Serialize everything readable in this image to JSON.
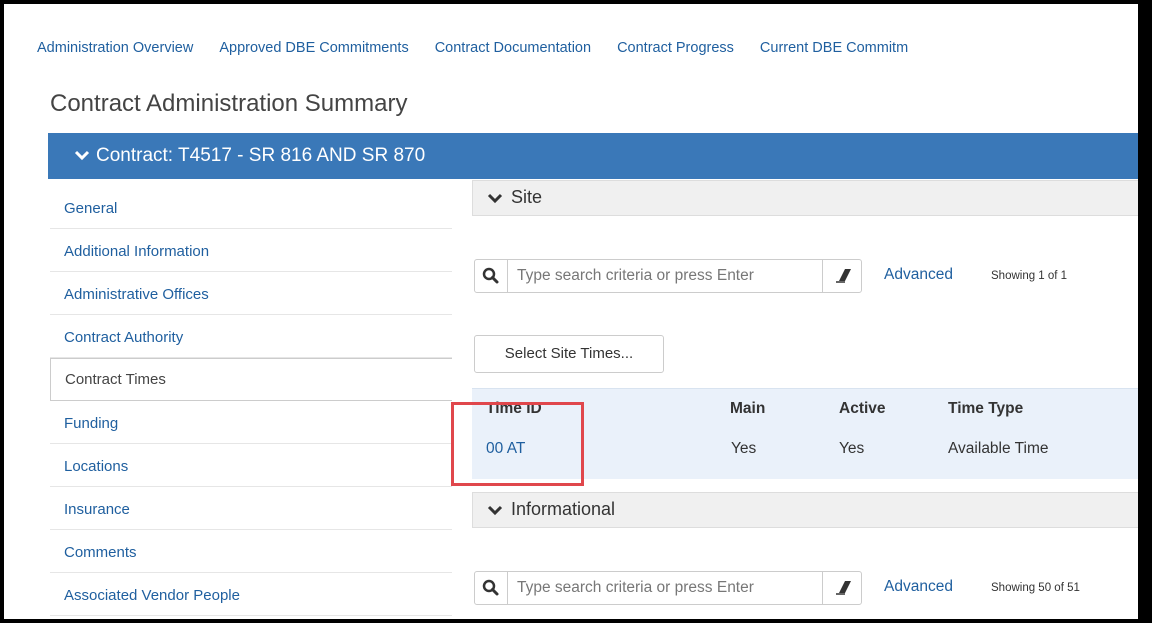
{
  "topnav": {
    "items": [
      "Administration Overview",
      "Approved DBE Commitments",
      "Contract Documentation",
      "Contract Progress",
      "Current DBE Commitm"
    ]
  },
  "page_title": "Contract Administration Summary",
  "contract_bar": {
    "label": "Contract: T4517 - SR 816 AND SR 870"
  },
  "sidebar": {
    "items": [
      "General",
      "Additional Information",
      "Administrative Offices",
      "Contract Authority",
      "Contract Times",
      "Funding",
      "Locations",
      "Insurance",
      "Comments",
      "Associated Vendor People"
    ],
    "active": "Contract Times"
  },
  "site": {
    "title": "Site",
    "search_placeholder": "Type search criteria or press Enter",
    "advanced_label": "Advanced",
    "showing": "Showing 1 of 1",
    "select_button": "Select Site Times...",
    "table": {
      "headers": [
        "Time ID",
        "Main",
        "Active",
        "Time Type"
      ],
      "rows": [
        [
          "00 AT",
          "Yes",
          "Yes",
          "Available Time"
        ]
      ]
    }
  },
  "informational": {
    "title": "Informational",
    "search_placeholder": "Type search criteria or press Enter",
    "advanced_label": "Advanced",
    "showing": "Showing 50 of 51"
  },
  "icons": {
    "chevron": "chevron-down-icon",
    "search": "search-icon",
    "eraser": "eraser-icon"
  },
  "colors": {
    "link": "#1f5f9f",
    "contract_bar": "#3a78b8",
    "highlight": "#e0474c",
    "table_bg": "#eaf1fa"
  }
}
